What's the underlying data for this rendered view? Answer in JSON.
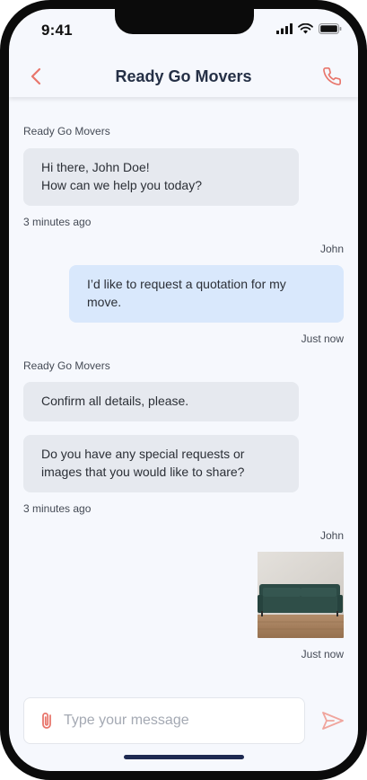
{
  "status_bar": {
    "time": "9:41"
  },
  "header": {
    "title": "Ready Go Movers"
  },
  "messages": [
    {
      "sender": "Ready Go Movers",
      "bubbles": [
        [
          "Hi there, John Doe!",
          "How can we help you today?"
        ]
      ],
      "timestamp": "3 minutes ago"
    },
    {
      "sender": "John",
      "bubbles": [
        [
          "I’d like to request a quotation for my",
          "move."
        ]
      ],
      "timestamp": "Just now"
    },
    {
      "sender": "Ready Go Movers",
      "bubbles": [
        [
          "Confirm all details, please."
        ],
        [
          "Do you have any special requests or",
          "images that you would like to share?"
        ]
      ],
      "timestamp": "3 minutes ago"
    },
    {
      "sender": "John",
      "attachment": "photo-of-green-sofa",
      "timestamp": "Just now"
    }
  ],
  "composer": {
    "placeholder": "Type your message",
    "value": ""
  },
  "icons": {
    "back": "chevron-left-icon",
    "call": "phone-icon",
    "attach": "paperclip-icon",
    "send": "send-icon"
  },
  "colors": {
    "accent": "#e8766c",
    "incoming_bubble": "#e6e9ef",
    "outgoing_bubble": "#d9e8fc",
    "title": "#253046"
  }
}
